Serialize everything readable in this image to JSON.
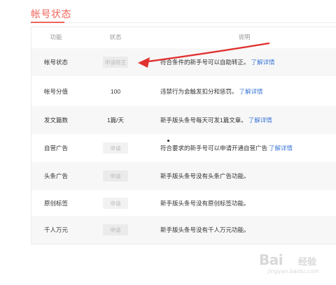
{
  "page": {
    "title": "帐号状态"
  },
  "table": {
    "headers": {
      "feature": "功能",
      "status": "状态",
      "description": "说明"
    },
    "rows": [
      {
        "feature": "帐号状态",
        "status": "申请转正",
        "description": "符合条件的新手号可以自助转正。",
        "link": "了解详情"
      },
      {
        "feature": "帐号分值",
        "status": "100",
        "description": "违禁行为会触发扣分和惩罚。",
        "link": "了解详情"
      },
      {
        "feature": "发文篇数",
        "status": "1篇/天",
        "description": "新手版头条号每天可发1篇文章。",
        "link": "了解详情"
      },
      {
        "feature": "自营广告",
        "status": "申请",
        "description": "符合要求的新手号可以申请开通自营广告",
        "link": "了解详情"
      },
      {
        "feature": "头条广告",
        "status": "申请",
        "description": "新手版头条号没有头条广告功能。",
        "link": ""
      },
      {
        "feature": "原创标签",
        "status": "申请",
        "description": "新手版头条号没有原创标签功能。",
        "link": ""
      },
      {
        "feature": "千人万元",
        "status": "申请",
        "description": "新手版头条号没有千人万元功能。",
        "link": ""
      }
    ]
  },
  "annotation": {
    "arrow_color": "#e0312f"
  },
  "watermark": {
    "brand": "Bai",
    "brand_suffix": "经验",
    "url": "jingyan.baidu.com"
  }
}
